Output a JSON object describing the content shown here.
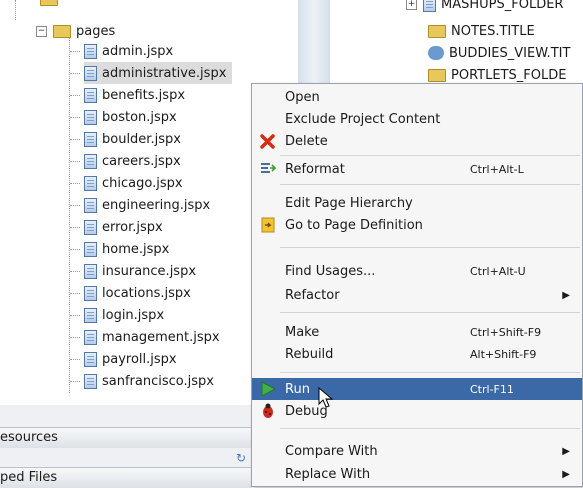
{
  "tree": {
    "top_partial": "",
    "folder_label": "pages",
    "files": [
      "admin.jspx",
      "administrative.jspx",
      "benefits.jspx",
      "boston.jspx",
      "boulder.jspx",
      "careers.jspx",
      "chicago.jspx",
      "engineering.jspx",
      "error.jspx",
      "home.jspx",
      "insurance.jspx",
      "locations.jspx",
      "login.jspx",
      "management.jspx",
      "payroll.jspx",
      "sanfrancisco.jspx"
    ],
    "selected_index": 1
  },
  "right_tree": {
    "items": [
      "MASHUPS_FOLDER",
      "NOTES.TITLE",
      "BUDDIES_VIEW.TIT",
      "PORTLETS_FOLDE"
    ]
  },
  "bottom": {
    "panel1": "esources",
    "panel2": "ped Files"
  },
  "menu": {
    "open": "Open",
    "exclude": "Exclude Project Content",
    "delete": "Delete",
    "reformat": "Reformat",
    "reformat_sc": "Ctrl+Alt-L",
    "edit_hierarchy": "Edit Page Hierarchy",
    "goto_def": "Go to Page Definition",
    "find_usages": "Find Usages...",
    "find_usages_sc": "Ctrl+Alt-U",
    "refactor": "Refactor",
    "make": "Make",
    "make_sc": "Ctrl+Shift-F9",
    "rebuild": "Rebuild",
    "rebuild_sc": "Alt+Shift-F9",
    "run": "Run",
    "run_sc": "Ctrl-F11",
    "debug": "Debug",
    "compare": "Compare With",
    "replace": "Replace With"
  },
  "colors": {
    "highlight": "#3b69a8",
    "selection": "#dcdcdc"
  }
}
